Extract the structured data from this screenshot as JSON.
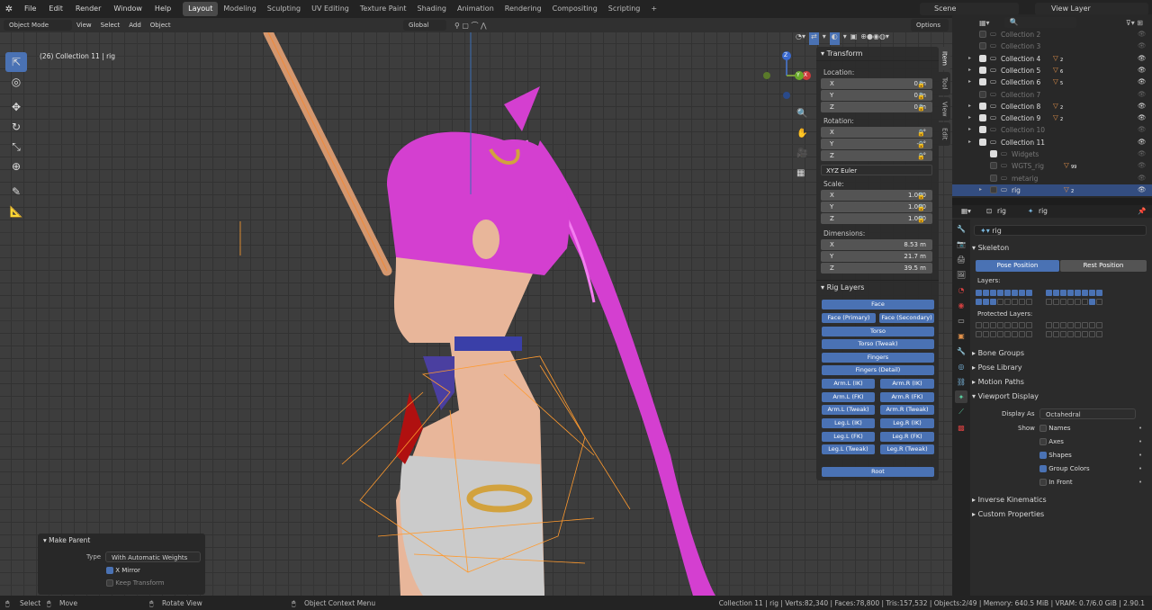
{
  "topbar": {
    "menus": [
      "File",
      "Edit",
      "Render",
      "Window",
      "Help"
    ],
    "workspaces": [
      "Layout",
      "Modeling",
      "Sculpting",
      "UV Editing",
      "Texture Paint",
      "Shading",
      "Animation",
      "Rendering",
      "Compositing",
      "Scripting"
    ],
    "plus": "+",
    "scene": "Scene",
    "view_layer": "View Layer"
  },
  "viewport_header": {
    "mode": "Object Mode",
    "menus": [
      "View",
      "Select",
      "Add",
      "Object"
    ],
    "orientation": "Global",
    "options": "Options"
  },
  "viewport": {
    "info": "(26) Collection 11 | rig",
    "gizmo_x": "X",
    "gizmo_y": "Y",
    "gizmo_z": "Z"
  },
  "npanel": {
    "transform_title": "Transform",
    "location_label": "Location:",
    "location": [
      {
        "axis": "X",
        "value": "0 m"
      },
      {
        "axis": "Y",
        "value": "0 m"
      },
      {
        "axis": "Z",
        "value": "0 m"
      }
    ],
    "rotation_label": "Rotation:",
    "rotation": [
      {
        "axis": "X",
        "value": "0°"
      },
      {
        "axis": "Y",
        "value": "-0°"
      },
      {
        "axis": "Z",
        "value": "0°"
      }
    ],
    "rotation_mode": "XYZ Euler",
    "scale_label": "Scale:",
    "scale": [
      {
        "axis": "X",
        "value": "1.000"
      },
      {
        "axis": "Y",
        "value": "1.000"
      },
      {
        "axis": "Z",
        "value": "1.000"
      }
    ],
    "dimensions_label": "Dimensions:",
    "dimensions": [
      {
        "axis": "X",
        "value": "8.53 m"
      },
      {
        "axis": "Y",
        "value": "21.7 m"
      },
      {
        "axis": "Z",
        "value": "39.5 m"
      }
    ],
    "rig_layers_title": "Rig Layers",
    "rig_buttons": {
      "face": "Face",
      "face_primary": "Face (Primary)",
      "face_secondary": "Face (Secondary)",
      "torso": "Torso",
      "torso_tweak": "Torso (Tweak)",
      "fingers": "Fingers",
      "fingers_detail": "Fingers (Detail)",
      "arm_l_ik": "Arm.L (IK)",
      "arm_r_ik": "Arm.R (IK)",
      "arm_l_fk": "Arm.L (FK)",
      "arm_r_fk": "Arm.R (FK)",
      "arm_l_tweak": "Arm.L (Tweak)",
      "arm_r_tweak": "Arm.R (Tweak)",
      "leg_l_ik": "Leg.L (IK)",
      "leg_r_ik": "Leg.R (IK)",
      "leg_l_fk": "Leg.L (FK)",
      "leg_r_fk": "Leg.R (FK)",
      "leg_l_tweak": "Leg.L (Tweak)",
      "leg_r_tweak": "Leg.R (Tweak)",
      "root": "Root"
    },
    "tabs": [
      "Item",
      "Tool",
      "View",
      "Edit"
    ]
  },
  "outliner": {
    "rows": [
      {
        "name": "Collection 2",
        "checked": false,
        "dim": true,
        "expand": false,
        "badge": ""
      },
      {
        "name": "Collection 3",
        "checked": false,
        "dim": true,
        "expand": false,
        "badge": ""
      },
      {
        "name": "Collection 4",
        "checked": true,
        "dim": false,
        "expand": true,
        "badge": "2"
      },
      {
        "name": "Collection 5",
        "checked": true,
        "dim": false,
        "expand": true,
        "badge": "6"
      },
      {
        "name": "Collection 6",
        "checked": true,
        "dim": false,
        "expand": true,
        "badge": "5"
      },
      {
        "name": "Collection 7",
        "checked": false,
        "dim": true,
        "expand": false,
        "badge": ""
      },
      {
        "name": "Collection 8",
        "checked": true,
        "dim": false,
        "expand": true,
        "badge": "2"
      },
      {
        "name": "Collection 9",
        "checked": true,
        "dim": false,
        "expand": true,
        "badge": "2"
      },
      {
        "name": "Collection 10",
        "checked": true,
        "dim": true,
        "expand": true,
        "badge": ""
      },
      {
        "name": "Collection 11",
        "checked": true,
        "dim": false,
        "expand": true,
        "badge": ""
      },
      {
        "name": "Widgets",
        "checked": true,
        "dim": true,
        "expand": false,
        "badge": ""
      },
      {
        "name": "WGTS_rig",
        "checked": false,
        "dim": true,
        "expand": false,
        "badge": "99"
      },
      {
        "name": "metarig",
        "checked": false,
        "dim": true,
        "expand": false,
        "badge": ""
      },
      {
        "name": "rig",
        "checked": false,
        "dim": false,
        "expand": true,
        "badge": "2"
      }
    ]
  },
  "properties": {
    "header_a": "rig",
    "header_b": "rig",
    "object_name": "rig",
    "skeleton": "Skeleton",
    "pose_position": "Pose Position",
    "rest_position": "Rest Position",
    "layers": "Layers:",
    "protected_layers": "Protected Layers:",
    "bone_groups": "Bone Groups",
    "pose_library": "Pose Library",
    "motion_paths": "Motion Paths",
    "viewport_display": "Viewport Display",
    "display_as_label": "Display As",
    "display_as": "Octahedral",
    "show_label": "Show",
    "show_options": [
      {
        "label": "Names",
        "checked": false
      },
      {
        "label": "Axes",
        "checked": false
      },
      {
        "label": "Shapes",
        "checked": true
      },
      {
        "label": "Group Colors",
        "checked": true
      },
      {
        "label": "In Front",
        "checked": false
      }
    ],
    "inverse_kinematics": "Inverse Kinematics",
    "custom_properties": "Custom Properties"
  },
  "make_parent": {
    "title": "Make Parent",
    "type_label": "Type",
    "type_value": "With Automatic Weights",
    "x_mirror": "X Mirror",
    "keep_transform": "Keep Transform"
  },
  "statusbar": {
    "select": "Select",
    "move": "Move",
    "rotate_view": "Rotate View",
    "context_menu": "Object Context Menu",
    "stats": "Collection 11 | rig | Verts:82,340 | Faces:78,800 | Tris:157,532 | Objects:2/49 | Memory: 640.5 MiB | VRAM: 0.7/6.0 GiB | 2.90.1"
  },
  "colors": {
    "accent": "#4a72b4",
    "hair": "#d43fd0",
    "skin": "#e8b69a",
    "bone": "#ff9a2e"
  }
}
